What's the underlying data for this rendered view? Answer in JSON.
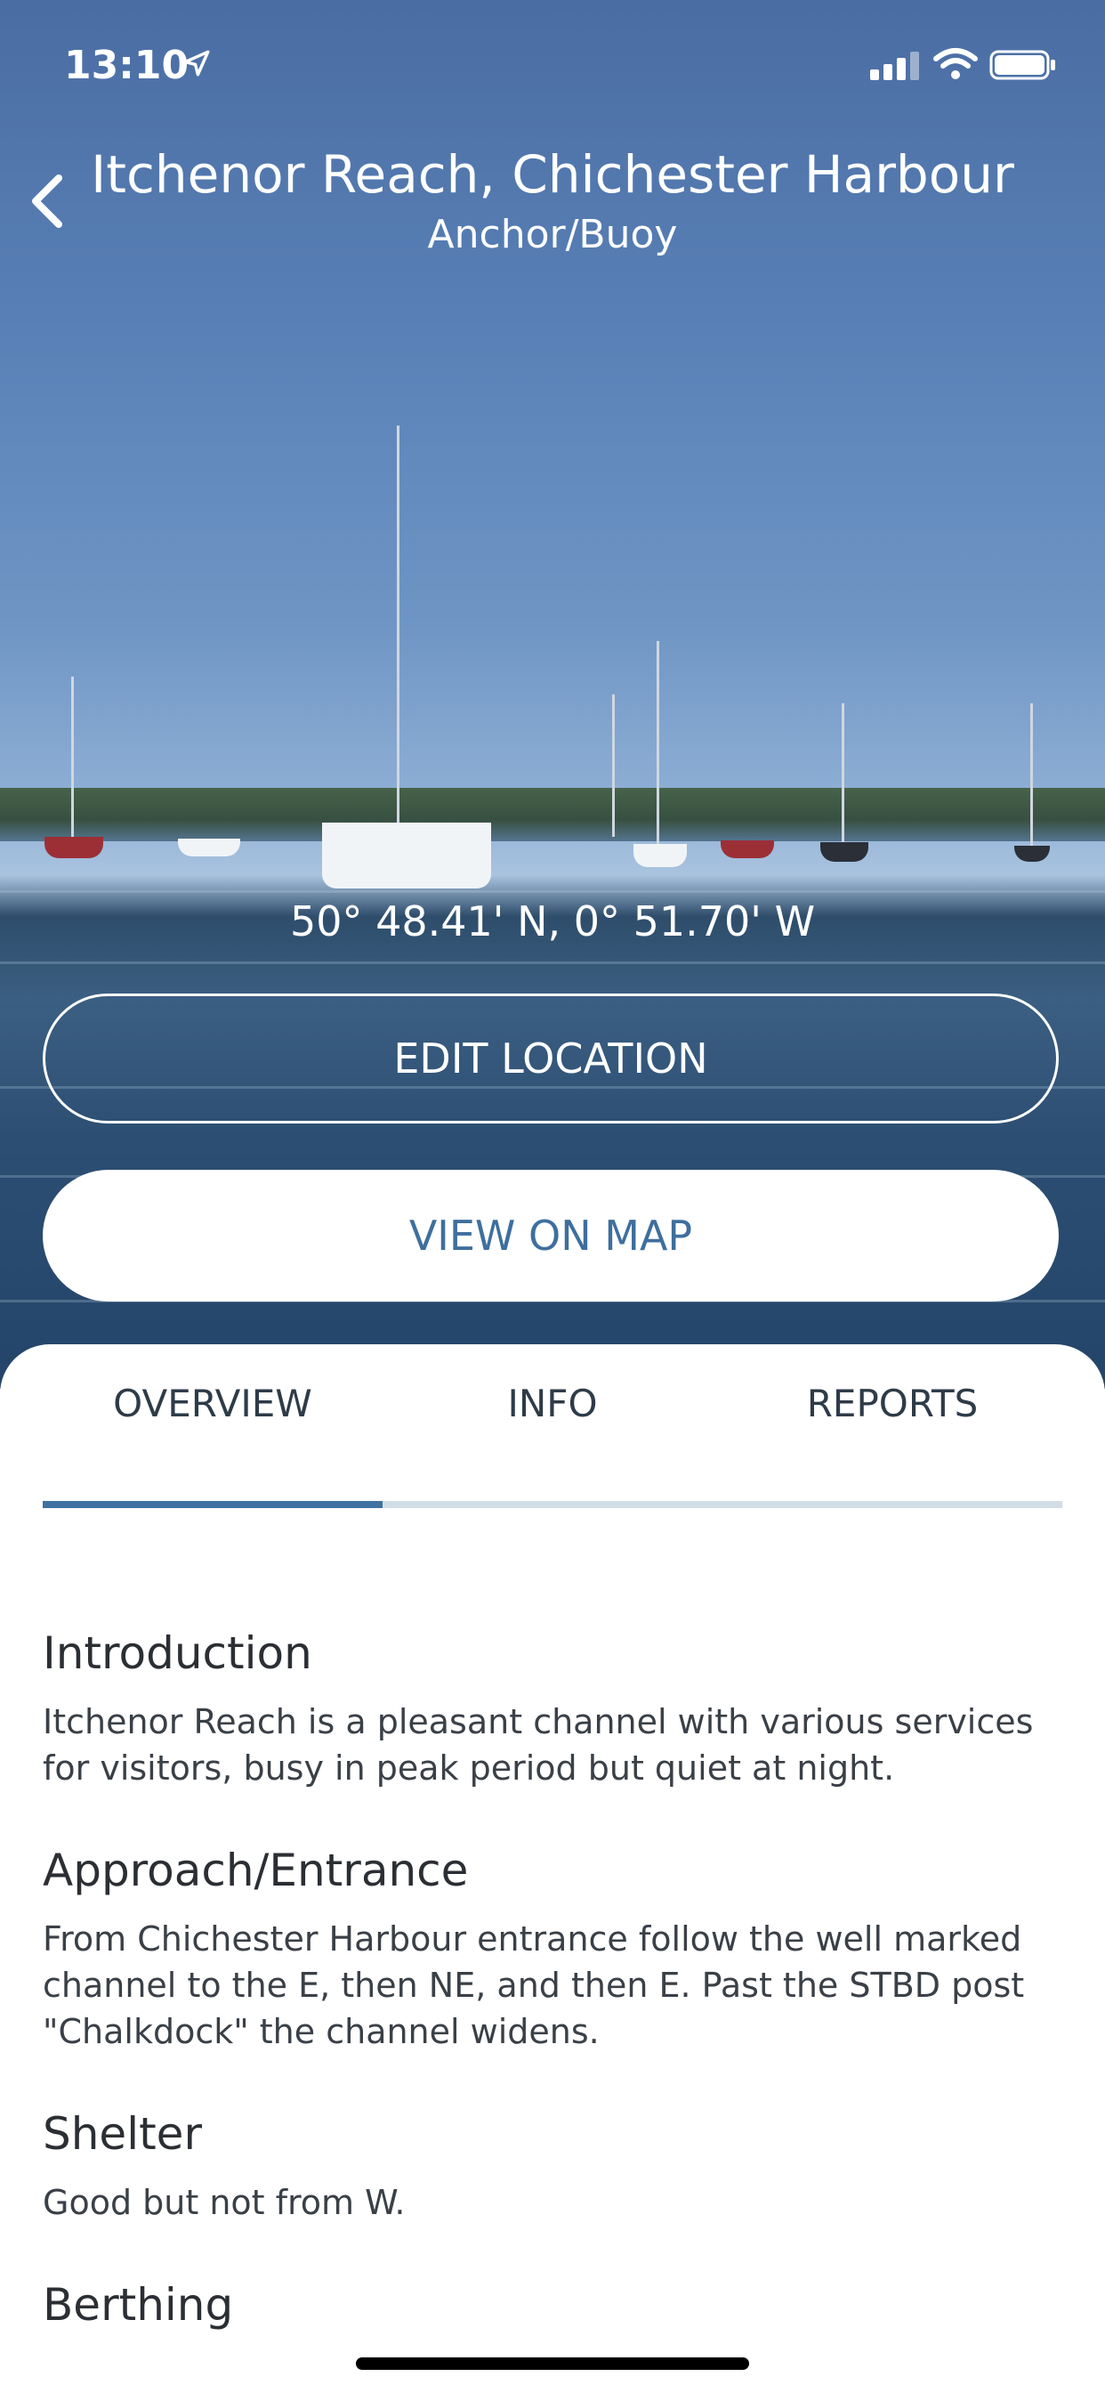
{
  "status_bar": {
    "time": "13:10"
  },
  "header": {
    "title": "Itchenor Reach, Chichester Harbour",
    "subtitle": "Anchor/Buoy"
  },
  "location": {
    "coordinates": "50° 48.41' N, 0° 51.70' W"
  },
  "buttons": {
    "edit_location": "EDIT LOCATION",
    "view_on_map": "VIEW ON MAP"
  },
  "tabs": [
    {
      "label": "OVERVIEW",
      "active": true
    },
    {
      "label": "INFO",
      "active": false
    },
    {
      "label": "REPORTS",
      "active": false
    }
  ],
  "sections": [
    {
      "heading": "Introduction",
      "body": "Itchenor Reach is a pleasant channel with various services for visitors, busy in peak period but quiet at night."
    },
    {
      "heading": "Approach/Entrance",
      "body": "From Chichester Harbour entrance follow the well marked channel to the E, then NE, and then E. Past the STBD post \"Chalkdock\" the channel widens."
    },
    {
      "heading": "Shelter",
      "body": "Good but not from W."
    },
    {
      "heading": "Berthing",
      "body": ""
    }
  ],
  "colors": {
    "accent": "#3f72a3",
    "tab_track": "#d2dde8",
    "text": "#2f353b"
  }
}
